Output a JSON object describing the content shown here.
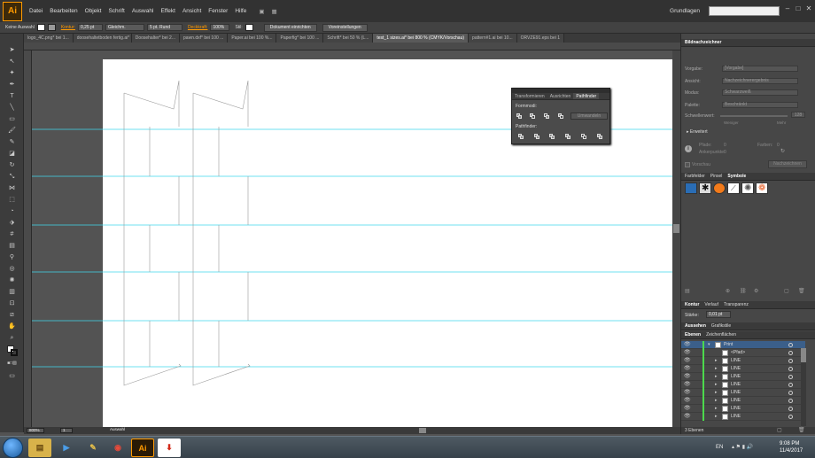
{
  "app": {
    "logo": "Ai",
    "workspace": "Grundlagen"
  },
  "menu": [
    "Datei",
    "Bearbeiten",
    "Objekt",
    "Schrift",
    "Auswahl",
    "Effekt",
    "Ansicht",
    "Fenster",
    "Hilfe"
  ],
  "control": {
    "selection": "Keine Auswahl",
    "stroke_label": "Kontur:",
    "stroke_weight": "0,25 pt",
    "stroke_profile": "Gleichm.",
    "brush": "5 pt. Rund",
    "opacity_label": "Deckkraft:",
    "opacity": "100%",
    "style_label": "Stil:",
    "doc_setup": "Dokument einrichten",
    "preferences": "Voreinstellungen"
  },
  "tabs": [
    {
      "label": "logo_4C.png* bei 1...",
      "active": false
    },
    {
      "label": "doosehaltetboden fertig.ai*",
      "active": false
    },
    {
      "label": "Doosehalter* bei 2...",
      "active": false
    },
    {
      "label": "pawn.dxf* bei 100 ...",
      "active": false
    },
    {
      "label": "Paper.ai bei 100 %...",
      "active": false
    },
    {
      "label": "Paperfig* bei 100 ...",
      "active": false
    },
    {
      "label": "Schrift* bei 50 % (L...",
      "active": false
    },
    {
      "label": "test_1 sizes.ai* bei 800 % (CMYK/Vorschau)",
      "active": true
    },
    {
      "label": "pattern#1.ai bei 10...",
      "active": false
    },
    {
      "label": "ORVZE91.eps bei 1",
      "active": false
    }
  ],
  "statusbar": {
    "zoom": "800%",
    "page": "1",
    "tool": "Auswahl"
  },
  "pathfinder": {
    "tabs": [
      {
        "label": "Transformieren",
        "active": false
      },
      {
        "label": "Ausrichten",
        "active": false
      },
      {
        "label": "Pathfinder",
        "active": true
      }
    ],
    "shape_modes": "Formmodi:",
    "expand": "Umwandeln",
    "pathfinders": "Pathfinder:"
  },
  "image_trace": {
    "title": "Bildnachzeichner",
    "rows": [
      {
        "label": "Vorgabe:",
        "value": "[Vorgabe]"
      },
      {
        "label": "Ansicht:",
        "value": "Nachzeichnerergebnis"
      },
      {
        "label": "Modus:",
        "value": "Schwarzweiß"
      },
      {
        "label": "Palette:",
        "value": "Beschränkt"
      }
    ],
    "threshold": "Schwellenwert:",
    "threshold_val": "128",
    "less": "Weniger",
    "more": "Mehr",
    "advanced": "Erweitert",
    "paths": "Pfade:",
    "paths_val": "0",
    "colors": "Farben:",
    "colors_val": "0",
    "anchors": "Ankerpunkte:",
    "anchors_val": "0",
    "preview": "Vorschau",
    "trace": "Nachzeichnen"
  },
  "swatch_panel": {
    "tabs": [
      {
        "label": "Farbfelder",
        "active": false
      },
      {
        "label": "Pinsel",
        "active": false
      },
      {
        "label": "Symbole",
        "active": true
      }
    ],
    "symbol_colors": [
      "#2a6db5",
      "#111111",
      "#f27a1a",
      "#ffffff",
      "#888888",
      "#e8622a"
    ]
  },
  "stroke_panel": {
    "tabs": [
      {
        "label": "Kontur",
        "active": true
      },
      {
        "label": "Verlauf",
        "active": false
      },
      {
        "label": "Transparenz",
        "active": false
      }
    ],
    "weight_label": "Stärke:",
    "weight": "0,01 pt"
  },
  "layers_panel": {
    "tabs": [
      {
        "label": "Aussehen",
        "active": true
      },
      {
        "label": "Grafikstile",
        "active": false
      }
    ],
    "subtabs": [
      {
        "label": "Ebenen",
        "active": true
      },
      {
        "label": "Zeichenflächen",
        "active": false
      }
    ],
    "rows": [
      {
        "name": "Print",
        "level": 0
      },
      {
        "name": "<Pfad>",
        "level": 1
      },
      {
        "name": "LINE",
        "level": 1
      },
      {
        "name": "LINE",
        "level": 1
      },
      {
        "name": "LINE",
        "level": 1
      },
      {
        "name": "LINE",
        "level": 1
      },
      {
        "name": "LINE",
        "level": 1
      },
      {
        "name": "LINE",
        "level": 1
      },
      {
        "name": "LINE",
        "level": 1
      },
      {
        "name": "LINE",
        "level": 1
      }
    ],
    "count": "3 Ebenen"
  },
  "taskbar": {
    "lang": "EN",
    "time": "9:08 PM",
    "date": "11/4/2017"
  },
  "colors": {
    "accent": "#ff9a00",
    "guide": "#3fd6ec",
    "layer_bar": "#4cd94c"
  }
}
